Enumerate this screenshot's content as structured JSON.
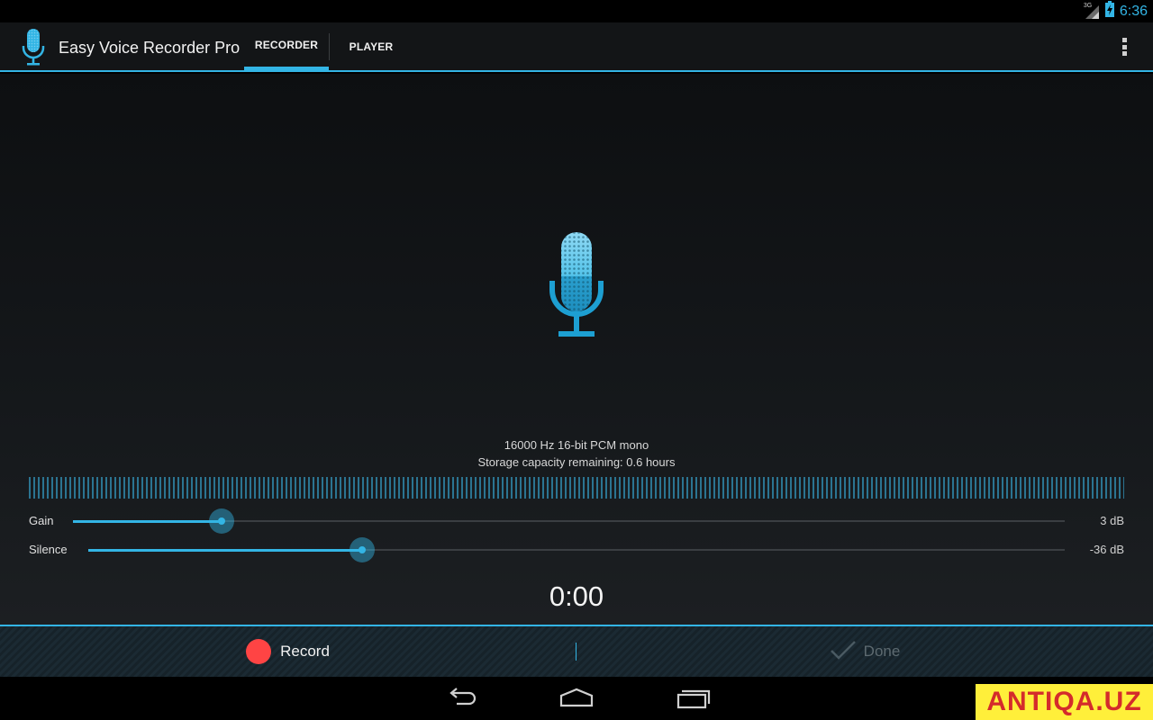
{
  "status_bar": {
    "network": "3G",
    "time": "6:36",
    "icons": [
      "signal-icon",
      "battery-icon"
    ]
  },
  "app": {
    "title": "Easy Voice Recorder Pro",
    "icon": "microphone-icon"
  },
  "tabs": [
    {
      "label": "RECORDER",
      "selected": true
    },
    {
      "label": "PLAYER",
      "selected": false
    }
  ],
  "recorder": {
    "format": "16000 Hz 16-bit PCM mono",
    "storage": "Storage capacity remaining: 0.6 hours",
    "gain": {
      "label": "Gain",
      "value": "3 dB",
      "level": 0.15
    },
    "silence": {
      "label": "Silence",
      "value": "-36 dB",
      "level": 0.28
    },
    "timer": "0:00"
  },
  "bottom_bar": {
    "record_label": "Record",
    "done_label": "Done"
  },
  "nav": {
    "icons": [
      "back-icon",
      "home-icon",
      "recents-icon"
    ]
  },
  "watermark": "ANTIQA.UZ",
  "colors": {
    "accent": "#33b5e5",
    "record": "#ff4444",
    "disabled": "#5d6a70"
  }
}
